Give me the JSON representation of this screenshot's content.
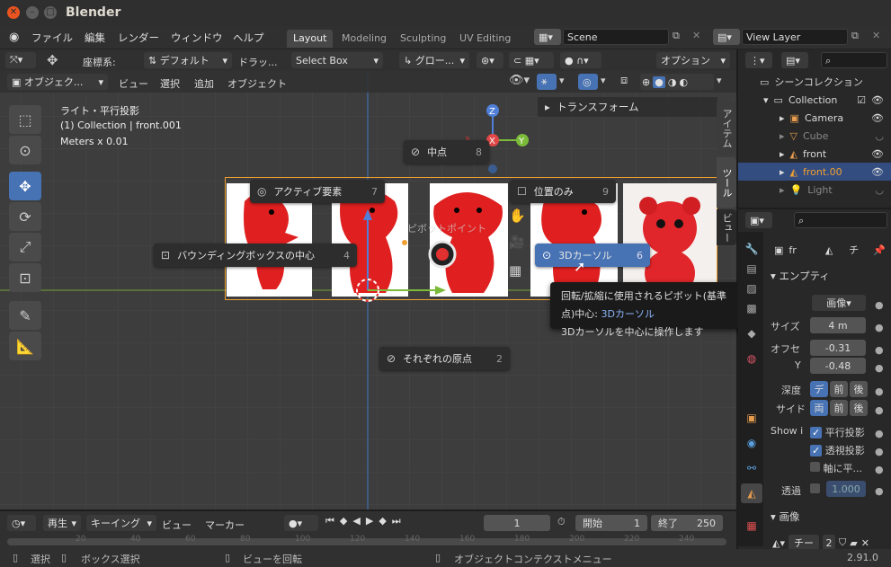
{
  "window": {
    "title": "Blender",
    "version": "2.91.0"
  },
  "menu": [
    "ファイル",
    "編集",
    "レンダー",
    "ウィンドウ",
    "ヘルプ"
  ],
  "workspaces": [
    "Layout",
    "Modeling",
    "Sculpting",
    "UV Editing"
  ],
  "scene": {
    "label": "Scene",
    "view_layer": "View Layer"
  },
  "header": {
    "coord_label": "座標系:",
    "coord_value": "デフォルト",
    "drag_label": "ドラッ...",
    "select_box": "Select Box",
    "global": "グロー...",
    "options": "オプション"
  },
  "header2": {
    "mode": "オブジェク...",
    "items": [
      "ビュー",
      "選択",
      "追加",
      "オブジェクト"
    ]
  },
  "viewport_info": {
    "line1": "ライト・平行投影",
    "line2": "(1) Collection | front.001",
    "line3": "Meters x 0.01"
  },
  "n_panel": {
    "transform": "トランスフォーム",
    "tabs": [
      "アイテム",
      "ツール",
      "ビュー"
    ]
  },
  "pie": {
    "title": "ピボットポイント",
    "items": [
      {
        "label": "中点",
        "num": "8"
      },
      {
        "label": "アクティブ要素",
        "num": "7"
      },
      {
        "label": "位置のみ",
        "num": "9"
      },
      {
        "label": "バウンディングボックスの中心",
        "num": "4"
      },
      {
        "label": "3Dカーソル",
        "num": "6"
      },
      {
        "label": "それぞれの原点",
        "num": "2"
      }
    ]
  },
  "tooltip": {
    "line1_prefix": "回転/拡縮に使用されるピボット(基準点)中心: ",
    "line1_value": "3Dカーソル",
    "line2": "3Dカーソルを中心に操作します"
  },
  "outliner": {
    "root": "シーンコレクション",
    "items": [
      {
        "label": "Collection",
        "icon": "collection-icon"
      },
      {
        "label": "Camera",
        "icon": "camera-icon"
      },
      {
        "label": "Cube",
        "icon": "mesh-icon"
      },
      {
        "label": "front",
        "icon": "image-empty-icon"
      },
      {
        "label": "front.00",
        "icon": "image-empty-icon"
      },
      {
        "label": "Light",
        "icon": "light-icon"
      }
    ]
  },
  "properties": {
    "section": "エンプティ",
    "obj_name": "fr",
    "chi": "チ",
    "image_label": "画像",
    "size_label": "サイズ",
    "size_value": "4 m",
    "offset_label": "オフセ",
    "offset_x": "-0.31",
    "y_label": "Y",
    "offset_y": "-0.48",
    "depth_label": "深度",
    "depth_opts": [
      "デ",
      "前",
      "後"
    ],
    "side_label": "サイド",
    "side_opts": [
      "両",
      "前",
      "後"
    ],
    "show_label": "Show i",
    "chk1": "平行投影",
    "chk2": "透視投影",
    "chk3": "軸に平...",
    "transp_label": "透過",
    "transp_value": "1.000",
    "image_section": "画像",
    "image_field": "チー",
    "image_users": "2"
  },
  "timeline": {
    "playback": "再生",
    "keying": "キーイング",
    "view": "ビュー",
    "marker": "マーカー",
    "frame": "1",
    "start_label": "開始",
    "start": "1",
    "end_label": "終了",
    "end": "250",
    "ticks": [
      "20",
      "40",
      "60",
      "80",
      "100",
      "120",
      "140",
      "160",
      "180",
      "200",
      "220",
      "240"
    ]
  },
  "status": {
    "select": "選択",
    "box_select": "ボックス選択",
    "rotate": "ビューを回転",
    "context": "オブジェクトコンテクストメニュー"
  }
}
